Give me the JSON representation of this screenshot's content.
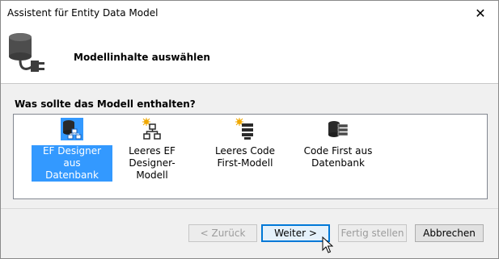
{
  "window": {
    "title": "Assistent für Entity Data Model"
  },
  "header": {
    "title": "Modellinhalte auswählen"
  },
  "question": "Was sollte das Modell enthalten?",
  "options": [
    {
      "label_line1": "EF Designer aus",
      "label_line2": "Datenbank",
      "icon": "database-model-icon",
      "selected": true
    },
    {
      "label_line1": "Leeres EF",
      "label_line2": "Designer-Modell",
      "icon": "empty-model-icon",
      "selected": false
    },
    {
      "label_line1": "Leeres Code",
      "label_line2": "First-Modell",
      "icon": "empty-code-first-icon",
      "selected": false
    },
    {
      "label_line1": "Code First aus",
      "label_line2": "Datenbank",
      "icon": "code-first-database-icon",
      "selected": false
    }
  ],
  "buttons": {
    "back": "< Zurück",
    "next": "Weiter >",
    "finish": "Fertig stellen",
    "cancel": "Abbrechen"
  },
  "colors": {
    "selection": "#3399ff",
    "default_button_border": "#0078d7"
  }
}
